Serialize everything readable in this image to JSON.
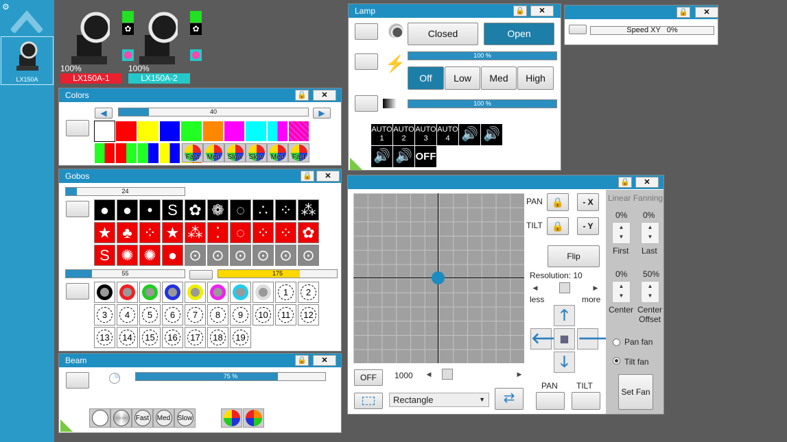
{
  "sidebar": {
    "fixture_label": "LX150A"
  },
  "fixtures": [
    {
      "name": "LX150A-1",
      "dimmer": "100%",
      "color": "#e8202f"
    },
    {
      "name": "LX150A-2",
      "dimmer": "100%",
      "color": "#25c8c8"
    }
  ],
  "colors": {
    "title": "Colors",
    "slider_value": "40",
    "slider_level": 0.16
  },
  "gobos": {
    "title": "Gobos",
    "slider1_value": "24",
    "slider1_level": 0.09,
    "slider2_value": "55",
    "slider2_level": 0.22,
    "slider3_value": "175",
    "slider3_level": 0.69,
    "numbers": [
      "1",
      "2",
      "3",
      "4",
      "5",
      "6",
      "7",
      "8",
      "9",
      "10",
      "11",
      "12",
      "13",
      "14",
      "15",
      "16",
      "17",
      "18",
      "19"
    ]
  },
  "beam": {
    "title": "Beam",
    "slider_value": "75 %",
    "slider_level": 0.75,
    "labels": [
      "Fast",
      "Med",
      "Slow"
    ]
  },
  "lamp": {
    "title": "Lamp",
    "closed": "Closed",
    "open": "Open",
    "dimmer_value": "100 %",
    "dimmer2_value": "100 %",
    "off": "Off",
    "low": "Low",
    "med": "Med",
    "high": "High",
    "auto": [
      "AUTO\n1",
      "AUTO\n2",
      "AUTO\n3",
      "AUTO\n4"
    ],
    "off_label": "OFF"
  },
  "speed": {
    "label": "Speed XY",
    "value": "0%"
  },
  "wheel_labels": [
    "Fast",
    "Med",
    "Slow",
    "Slow",
    "Med",
    "Fast"
  ],
  "xy": {
    "pan": "PAN",
    "tilt": "TILT",
    "minus_x": "- X",
    "minus_y": "- Y",
    "flip": "Flip",
    "resolution": "Resolution: 10",
    "less": "less",
    "more": "more",
    "off": "OFF",
    "value": "1000",
    "shape": "Rectangle",
    "pan_btn": "PAN",
    "tilt_btn": "TILT"
  },
  "fanning": {
    "title": "Linear Fanning",
    "first_val": "0%",
    "last_val": "0%",
    "first": "First",
    "last": "Last",
    "center_val": "0%",
    "offset_val": "50%",
    "center": "Center",
    "center_offset": "Center\nOffset",
    "pan_fan": "Pan fan",
    "tilt_fan": "Tilt fan",
    "set_fan": "Set Fan"
  }
}
